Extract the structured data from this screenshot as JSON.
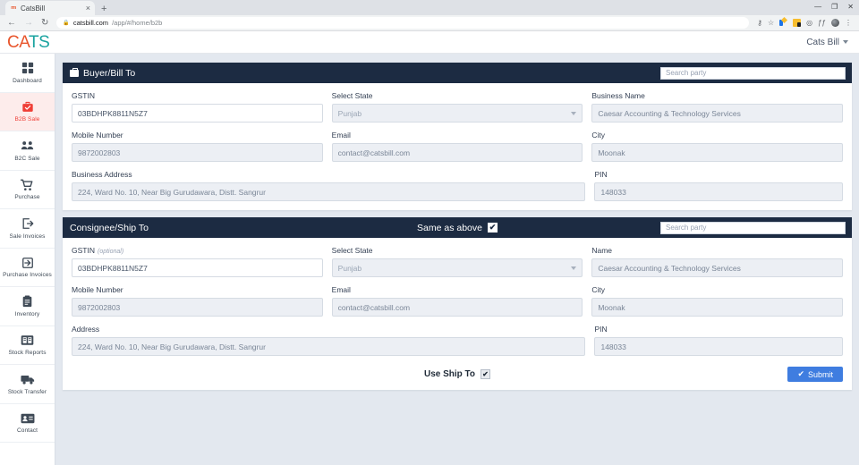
{
  "browser": {
    "tab_title": "CatsBill",
    "tab_favicon": "rm",
    "tab_close": "×",
    "new_tab": "+",
    "win_minimize": "—",
    "win_maximize": "❐",
    "win_close": "✕",
    "back": "←",
    "forward": "→",
    "reload": "↻",
    "lock": "🔒",
    "url_domain": "catsbill.com",
    "url_path": "/app/#/home/b2b",
    "key_icon": "⚷",
    "star_icon": "☆",
    "shield_icon": "◎",
    "script_icon": "ƒƒ",
    "menu_icon": "⋮"
  },
  "appbar": {
    "logo_part1": "CA",
    "logo_part2": "TS",
    "user_label": "Cats Bill"
  },
  "sidebar": {
    "items": [
      {
        "label": "Dashboard",
        "icon": "grid-icon",
        "active": false
      },
      {
        "label": "B2B Sale",
        "icon": "briefcase-check-icon",
        "active": true
      },
      {
        "label": "B2C Sale",
        "icon": "users-icon",
        "active": false
      },
      {
        "label": "Purchase",
        "icon": "cart-icon",
        "active": false
      },
      {
        "label": "Sale Invoices",
        "icon": "export-icon",
        "active": false
      },
      {
        "label": "Purchase Invoices",
        "icon": "import-icon",
        "active": false
      },
      {
        "label": "Inventory",
        "icon": "clipboard-icon",
        "active": false
      },
      {
        "label": "Stock Reports",
        "icon": "report-icon",
        "active": false
      },
      {
        "label": "Stock Transfer",
        "icon": "truck-icon",
        "active": false
      },
      {
        "label": "Contact",
        "icon": "contact-card-icon",
        "active": false
      }
    ]
  },
  "buyer": {
    "title": "Buyer/Bill To",
    "search_placeholder": "Search party",
    "gstin_label": "GSTIN",
    "gstin_value": "03BDHPK8811N5Z7",
    "state_label": "Select State",
    "state_value": "Punjab",
    "business_name_label": "Business Name",
    "business_name_value": "Caesar Accounting & Technology Services",
    "mobile_label": "Mobile Number",
    "mobile_value": "9872002803",
    "email_label": "Email",
    "email_value": "contact@catsbill.com",
    "city_label": "City",
    "city_value": "Moonak",
    "address_label": "Business Address",
    "address_value": "224, Ward No. 10, Near Big Gurudawara, Distt. Sangrur",
    "pin_label": "PIN",
    "pin_value": "148033"
  },
  "consignee": {
    "title": "Consignee/Ship To",
    "same_as_above_label": "Same as above",
    "same_as_above_checked": "✔",
    "search_placeholder": "Search party",
    "gstin_label": "GSTIN",
    "gstin_optional": "(optional)",
    "gstin_value": "03BDHPK8811N5Z7",
    "state_label": "Select State",
    "state_value": "Punjab",
    "name_label": "Name",
    "name_value": "Caesar Accounting & Technology Services",
    "mobile_label": "Mobile Number",
    "mobile_value": "9872002803",
    "email_label": "Email",
    "email_value": "contact@catsbill.com",
    "city_label": "City",
    "city_value": "Moonak",
    "address_label": "Address",
    "address_value": "224, Ward No. 10, Near Big Gurudawara, Distt. Sangrur",
    "pin_label": "PIN",
    "pin_value": "148033"
  },
  "footer": {
    "use_ship_to_label": "Use Ship To",
    "use_ship_to_checked": "✔",
    "submit_label": "Submit",
    "submit_icon": "✔"
  },
  "colors": {
    "brand_orange": "#e8552c",
    "brand_teal": "#1ba3a0",
    "header_navy": "#1c2b42",
    "active_red": "#ef3e36",
    "submit_blue": "#3f7de0",
    "content_bg": "#e3e8ef"
  }
}
